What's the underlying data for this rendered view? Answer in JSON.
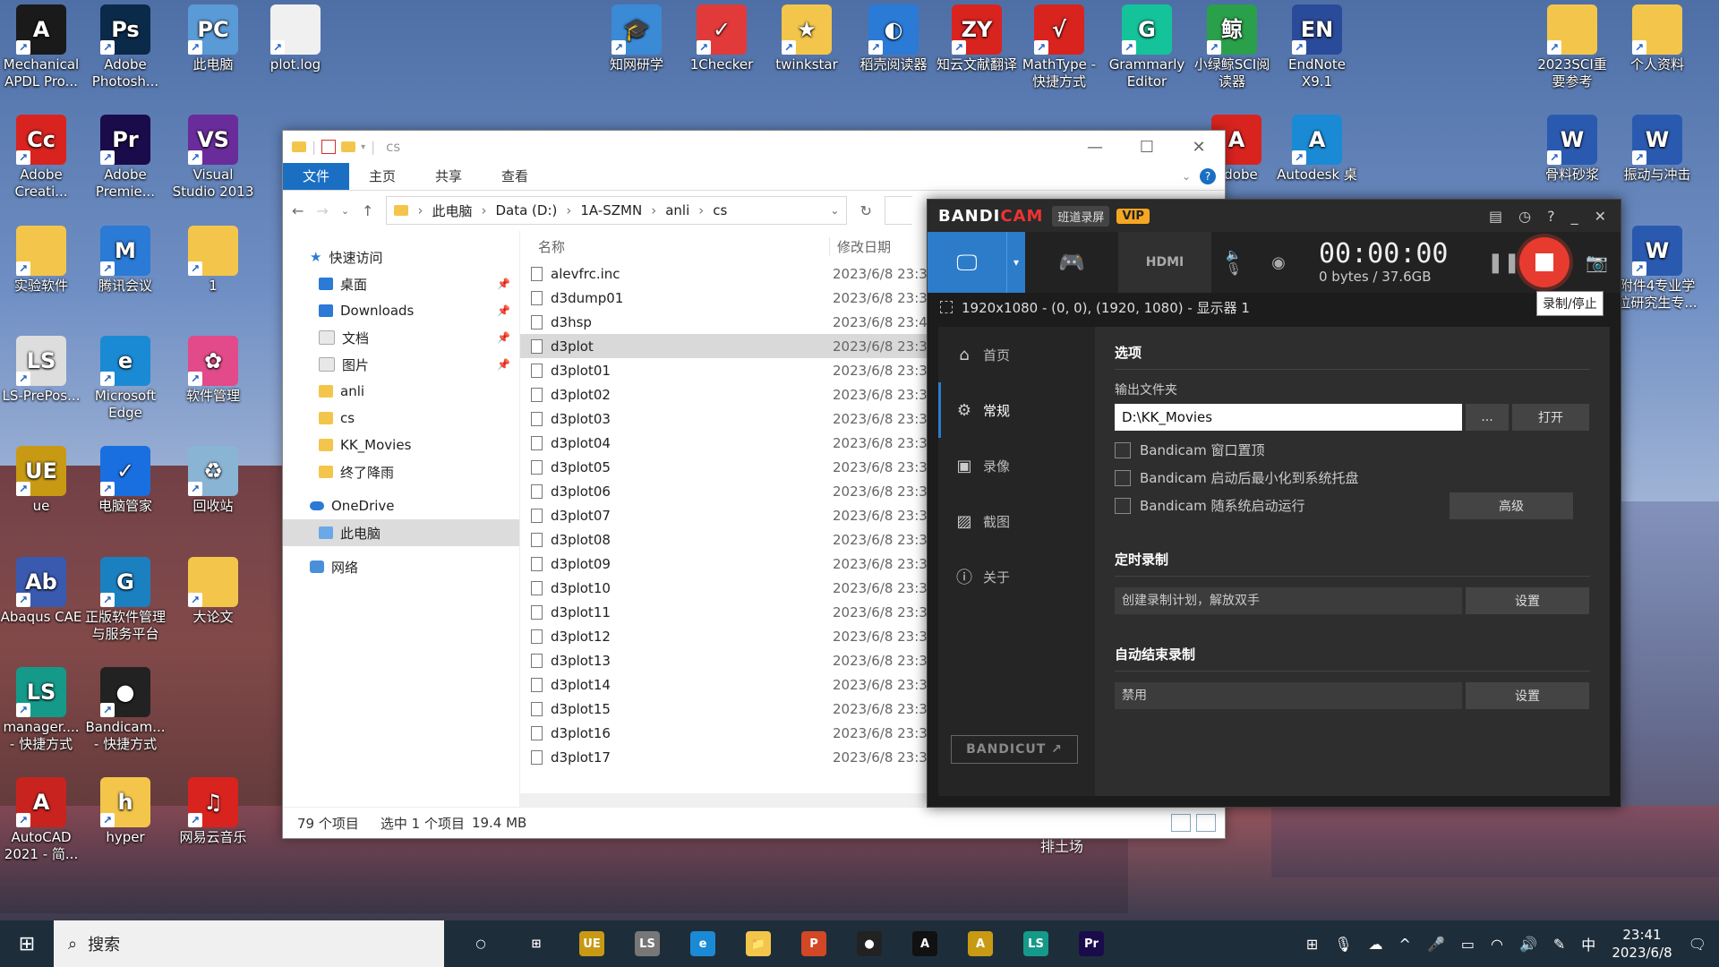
{
  "desktop_icons": [
    {
      "label": "Mechanical APDL Pro...",
      "glyph": "A",
      "color": "#1a1a1a"
    },
    {
      "label": "Adobe Photosh...",
      "glyph": "Ps",
      "color": "#0b2a4a"
    },
    {
      "label": "此电脑",
      "glyph": "PC",
      "color": "#5a9ad6"
    },
    {
      "label": "plot.log",
      "glyph": "",
      "color": "#f0f0f0"
    },
    {
      "label": "Adobe Creati...",
      "glyph": "Cc",
      "color": "#d9231f"
    },
    {
      "label": "Adobe Premie...",
      "glyph": "Pr",
      "color": "#1a0b4a"
    },
    {
      "label": "Visual Studio 2013",
      "glyph": "VS",
      "color": "#6a2c9a"
    },
    {
      "label": "实验软件",
      "glyph": "",
      "color": "#f3c64b"
    },
    {
      "label": "腾讯会议",
      "glyph": "M",
      "color": "#2a7ad6"
    },
    {
      "label": "1",
      "glyph": "",
      "color": "#f3c64b"
    },
    {
      "label": "LS-PrePos...",
      "glyph": "LS",
      "color": "#dddddd"
    },
    {
      "label": "Microsoft Edge",
      "glyph": "e",
      "color": "#1a8ad4"
    },
    {
      "label": "软件管理",
      "glyph": "✿",
      "color": "#e24a8a"
    },
    {
      "label": "ue",
      "glyph": "UE",
      "color": "#c89a14"
    },
    {
      "label": "电脑管家",
      "glyph": "✓",
      "color": "#1a6fe0"
    },
    {
      "label": "回收站",
      "glyph": "♻",
      "color": "#8ab4d4"
    },
    {
      "label": "Abaqus CAE",
      "glyph": "Ab",
      "color": "#3a5ab0"
    },
    {
      "label": "正版软件管理与服务平台",
      "glyph": "G",
      "color": "#1a80c0"
    },
    {
      "label": "大论文",
      "glyph": "",
      "color": "#f3c64b"
    },
    {
      "label": "manager.... - 快捷方式",
      "glyph": "LS",
      "color": "#159a8a"
    },
    {
      "label": "Bandicam... - 快捷方式",
      "glyph": "●",
      "color": "#222222"
    },
    {
      "label": "AutoCAD 2021 - 简...",
      "glyph": "A",
      "color": "#c8231f"
    },
    {
      "label": "hyper",
      "glyph": "h",
      "color": "#f3c64b"
    },
    {
      "label": "网易云音乐",
      "glyph": "♫",
      "color": "#d9231f"
    },
    {
      "label": "知网研学",
      "glyph": "🎓",
      "color": "#3a8ad6"
    },
    {
      "label": "1Checker",
      "glyph": "✓",
      "color": "#e23a3a"
    },
    {
      "label": "twinkstar",
      "glyph": "★",
      "color": "#f3c64b"
    },
    {
      "label": "稻壳阅读器",
      "glyph": "◐",
      "color": "#2a7ad6"
    },
    {
      "label": "知云文献翻译",
      "glyph": "ZY",
      "color": "#d9231f"
    },
    {
      "label": "MathType - 快捷方式",
      "glyph": "√",
      "color": "#d9231f"
    },
    {
      "label": "Grammarly Editor",
      "glyph": "G",
      "color": "#15c39a"
    },
    {
      "label": "小绿鲸SCI阅读器",
      "glyph": "鲸",
      "color": "#2aa04a"
    },
    {
      "label": "EndNote X9.1",
      "glyph": "EN",
      "color": "#2a4a9a"
    },
    {
      "label": "Adobe",
      "glyph": "A",
      "color": "#d9231f"
    },
    {
      "label": "Autodesk 桌",
      "glyph": "A",
      "color": "#1a8ad4"
    },
    {
      "label": "2023SCI重要参考",
      "glyph": "",
      "color": "#f3c64b"
    },
    {
      "label": "个人资料",
      "glyph": "",
      "color": "#f3c64b"
    },
    {
      "label": "骨料砂浆",
      "glyph": "W",
      "color": "#2a5ab0"
    },
    {
      "label": "振动与冲击",
      "glyph": "W",
      "color": "#2a5ab0"
    },
    {
      "label": "附件4专业学位研究生专...",
      "glyph": "W",
      "color": "#2a5ab0"
    }
  ],
  "explorer": {
    "title": "cs",
    "ribbon": [
      "文件",
      "主页",
      "共享",
      "查看"
    ],
    "breadcrumb": [
      "此电脑",
      "Data (D:)",
      "1A-SZMN",
      "anli",
      "cs"
    ],
    "nav": [
      {
        "label": "快速访问",
        "icon": "star",
        "pinned": false,
        "sub": false
      },
      {
        "label": "桌面",
        "icon": "blue",
        "pinned": true,
        "sub": true
      },
      {
        "label": "Downloads",
        "icon": "blue",
        "pinned": true,
        "sub": true
      },
      {
        "label": "文档",
        "icon": "doc",
        "pinned": true,
        "sub": true
      },
      {
        "label": "图片",
        "icon": "doc",
        "pinned": true,
        "sub": true
      },
      {
        "label": "anli",
        "icon": "folder",
        "pinned": false,
        "sub": true
      },
      {
        "label": "cs",
        "icon": "folder",
        "pinned": false,
        "sub": true
      },
      {
        "label": "KK_Movies",
        "icon": "folder",
        "pinned": false,
        "sub": true
      },
      {
        "label": "终了降雨",
        "icon": "folder",
        "pinned": false,
        "sub": true
      },
      {
        "label": "OneDrive",
        "icon": "cloud",
        "pinned": false,
        "sub": false
      },
      {
        "label": "此电脑",
        "icon": "pc",
        "pinned": false,
        "sub": true,
        "selected": true
      },
      {
        "label": "网络",
        "icon": "net",
        "pinned": false,
        "sub": false
      }
    ],
    "columns": [
      "名称",
      "修改日期"
    ],
    "files": [
      {
        "name": "alevfrc.inc",
        "date": "2023/6/8 23:3"
      },
      {
        "name": "d3dump01",
        "date": "2023/6/8 23:3"
      },
      {
        "name": "d3hsp",
        "date": "2023/6/8 23:4"
      },
      {
        "name": "d3plot",
        "date": "2023/6/8 23:3",
        "selected": true
      },
      {
        "name": "d3plot01",
        "date": "2023/6/8 23:3"
      },
      {
        "name": "d3plot02",
        "date": "2023/6/8 23:3"
      },
      {
        "name": "d3plot03",
        "date": "2023/6/8 23:3"
      },
      {
        "name": "d3plot04",
        "date": "2023/6/8 23:3"
      },
      {
        "name": "d3plot05",
        "date": "2023/6/8 23:3"
      },
      {
        "name": "d3plot06",
        "date": "2023/6/8 23:3"
      },
      {
        "name": "d3plot07",
        "date": "2023/6/8 23:3"
      },
      {
        "name": "d3plot08",
        "date": "2023/6/8 23:3"
      },
      {
        "name": "d3plot09",
        "date": "2023/6/8 23:3"
      },
      {
        "name": "d3plot10",
        "date": "2023/6/8 23:3"
      },
      {
        "name": "d3plot11",
        "date": "2023/6/8 23:3"
      },
      {
        "name": "d3plot12",
        "date": "2023/6/8 23:3"
      },
      {
        "name": "d3plot13",
        "date": "2023/6/8 23:3"
      },
      {
        "name": "d3plot14",
        "date": "2023/6/8 23:3"
      },
      {
        "name": "d3plot15",
        "date": "2023/6/8 23:3"
      },
      {
        "name": "d3plot16",
        "date": "2023/6/8 23:3"
      },
      {
        "name": "d3plot17",
        "date": "2023/6/8 23:3"
      }
    ],
    "status": {
      "count": "79 个项目",
      "selected": "选中 1 个项目",
      "size": "19.4 MB"
    }
  },
  "bandicam": {
    "logo_a": "BANDI",
    "logo_b": "CAM",
    "badge": "班道录屏",
    "vip": "VIP",
    "timer": "00:00:00",
    "size": "0 bytes / 37.6GB",
    "tooltip": "录制/停止",
    "area": "1920x1080 - (0, 0), (1920, 1080) - 显示器 1",
    "hdmi": "HDMI",
    "sidebar": [
      {
        "label": "首页",
        "icon": "⌂"
      },
      {
        "label": "常规",
        "icon": "⚙",
        "active": true
      },
      {
        "label": "录像",
        "icon": "▣"
      },
      {
        "label": "截图",
        "icon": "▨"
      },
      {
        "label": "关于",
        "icon": "ⓘ"
      }
    ],
    "bandicut": "BANDICUT ↗",
    "options": {
      "title": "选项",
      "output_label": "输出文件夹",
      "output_value": "D:\\KK_Movies",
      "browse": "...",
      "open": "打开",
      "checks": [
        "Bandicam 窗口置顶",
        "Bandicam 启动后最小化到系统托盘",
        "Bandicam 随系统启动运行"
      ],
      "advanced": "高级"
    },
    "schedule": {
      "title": "定时录制",
      "desc": "创建录制计划，解放双手",
      "button": "设置"
    },
    "autostop": {
      "title": "自动结束录制",
      "value": "禁用",
      "button": "设置"
    }
  },
  "taskbar": {
    "search": "搜索",
    "apps": [
      {
        "glyph": "○",
        "color": "transparent"
      },
      {
        "glyph": "⊞",
        "color": "transparent"
      },
      {
        "glyph": "UE",
        "color": "#c89a14"
      },
      {
        "glyph": "LS",
        "color": "#777777"
      },
      {
        "glyph": "e",
        "color": "#1a8ad4"
      },
      {
        "glyph": "📁",
        "color": "#f3c64b"
      },
      {
        "glyph": "P",
        "color": "#d24726"
      },
      {
        "glyph": "●",
        "color": "#222222"
      },
      {
        "glyph": "A",
        "color": "#111111"
      },
      {
        "glyph": "A",
        "color": "#c89a14"
      },
      {
        "glyph": "LS",
        "color": "#159a8a"
      },
      {
        "glyph": "Pr",
        "color": "#1a0b4a"
      }
    ],
    "ime": "中",
    "time": "23:41",
    "date": "2023/6/8",
    "wallpaper_text": "排土场"
  }
}
